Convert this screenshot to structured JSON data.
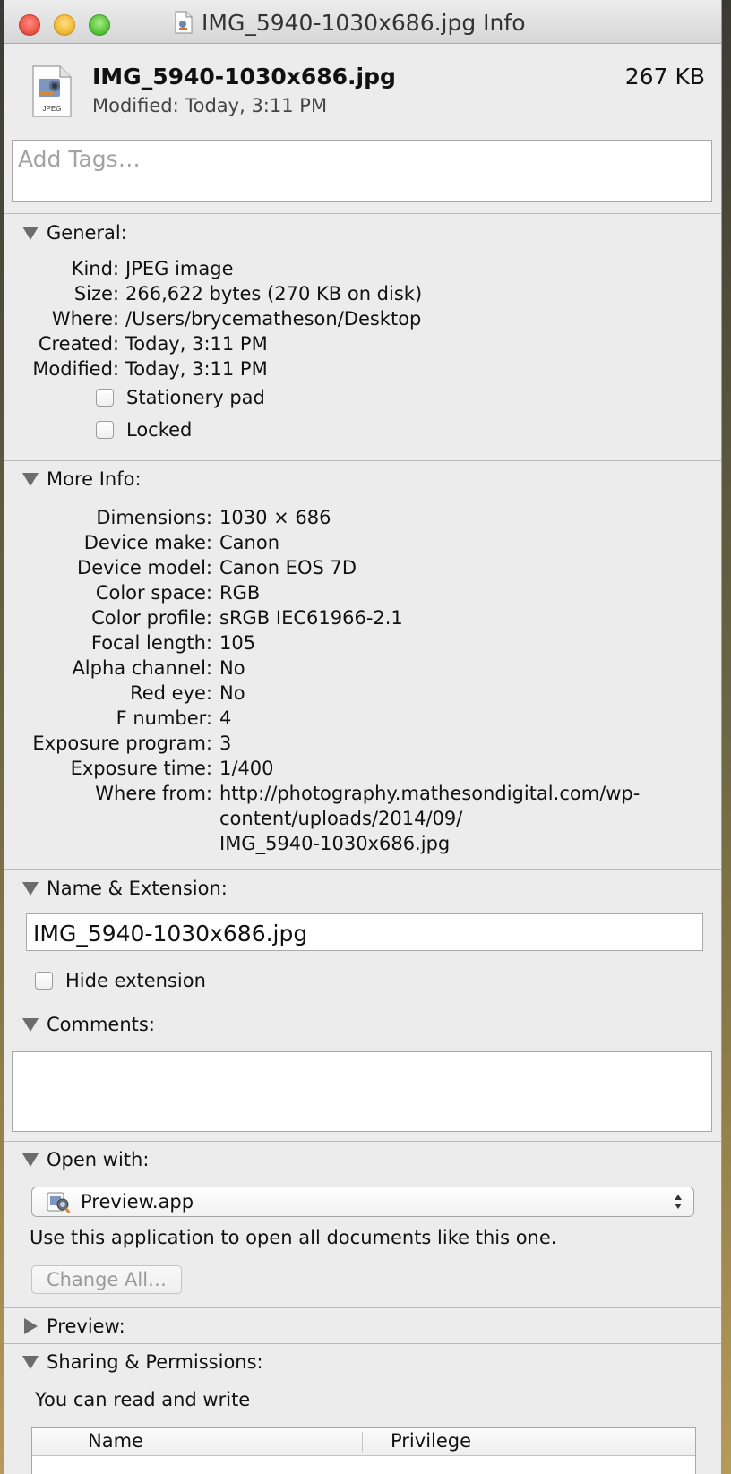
{
  "window": {
    "title": "IMG_5940-1030x686.jpg Info"
  },
  "header": {
    "file_name": "IMG_5940-1030x686.jpg",
    "file_size": "267 KB",
    "modified": "Modified: Today, 3:11 PM",
    "file_icon_label": "JPEG"
  },
  "tags": {
    "placeholder": "Add Tags…"
  },
  "general": {
    "title": "General:",
    "rows": [
      {
        "label": "Kind:",
        "value": "JPEG image"
      },
      {
        "label": "Size:",
        "value": "266,622 bytes (270 KB on disk)"
      },
      {
        "label": "Where:",
        "value": "/Users/brycematheson/Desktop"
      },
      {
        "label": "Created:",
        "value": "Today, 3:11 PM"
      },
      {
        "label": "Modified:",
        "value": "Today, 3:11 PM"
      }
    ],
    "stationery_label": "Stationery pad",
    "stationery_checked": false,
    "locked_label": "Locked",
    "locked_checked": false
  },
  "more_info": {
    "title": "More Info:",
    "rows": [
      {
        "label": "Dimensions:",
        "value": "1030 × 686"
      },
      {
        "label": "Device make:",
        "value": "Canon"
      },
      {
        "label": "Device model:",
        "value": "Canon EOS 7D"
      },
      {
        "label": "Color space:",
        "value": "RGB"
      },
      {
        "label": "Color profile:",
        "value": "sRGB IEC61966-2.1"
      },
      {
        "label": "Focal length:",
        "value": "105"
      },
      {
        "label": "Alpha channel:",
        "value": "No"
      },
      {
        "label": "Red eye:",
        "value": "No"
      },
      {
        "label": "F number:",
        "value": "4"
      },
      {
        "label": "Exposure program:",
        "value": "3"
      },
      {
        "label": "Exposure time:",
        "value": "1/400"
      }
    ],
    "where_from_label": "Where from:",
    "where_from_lines": [
      "http://photography.mathesondigital.com/wp-",
      "content/uploads/2014/09/",
      "IMG_5940-1030x686.jpg"
    ]
  },
  "name_ext": {
    "title": "Name & Extension:",
    "value": "IMG_5940-1030x686.jpg",
    "hide_extension_label": "Hide extension",
    "hide_extension_checked": false
  },
  "comments": {
    "title": "Comments:"
  },
  "open_with": {
    "title": "Open with:",
    "app": "Preview.app",
    "help_text": "Use this application to open all documents like this one.",
    "change_all_label": "Change All…"
  },
  "preview": {
    "title": "Preview:"
  },
  "sharing": {
    "title": "Sharing & Permissions:",
    "status": "You can read and write",
    "columns": [
      "Name",
      "Privilege"
    ]
  }
}
